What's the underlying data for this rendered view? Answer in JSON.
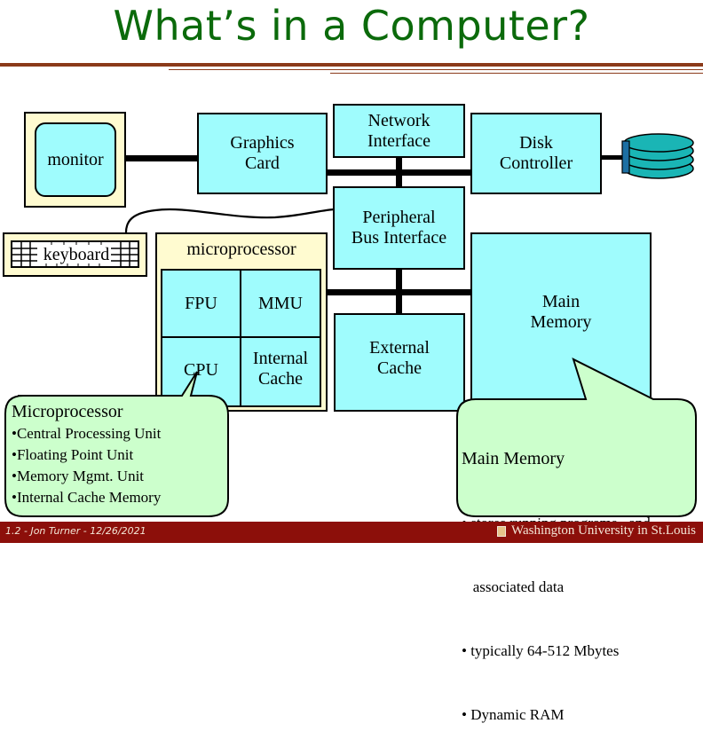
{
  "slide": {
    "title": "What’s in a Computer?"
  },
  "components": {
    "monitor": "monitor",
    "graphics_card": [
      "Graphics",
      "Card"
    ],
    "network_interface": [
      "Network",
      "Interface"
    ],
    "disk_controller": [
      "Disk",
      "Controller"
    ],
    "peripheral_bus_interface": [
      "Peripheral",
      "Bus Interface"
    ],
    "keyboard": "keyboard",
    "microprocessor": "microprocessor",
    "fpu": "FPU",
    "mmu": "MMU",
    "cpu": "CPU",
    "internal_cache": [
      "Internal",
      "Cache"
    ],
    "external_cache": [
      "External",
      "Cache"
    ],
    "main_memory": [
      "Main",
      "Memory"
    ],
    "disk_icon": "disk-stack-icon"
  },
  "callouts": {
    "microprocessor": {
      "title": "Microprocessor",
      "bullets": [
        "•Central Processing Unit",
        "•Floating Point Unit",
        "•Memory Mgmt. Unit",
        "•Internal Cache Memory"
      ]
    },
    "main_memory": {
      "title": "Main Memory",
      "bullets": [
        "• stores running programs   and",
        "   associated data",
        "• typically 64-512 Mbytes",
        "• Dynamic RAM"
      ]
    }
  },
  "footer": {
    "left": "1.2 - Jon Turner - 12/26/2021",
    "right": "Washington University in St.Louis"
  },
  "colors": {
    "title": "#0b6a0b",
    "component_fill": "#9ffcfd",
    "container_fill": "#fffbd0",
    "callout_fill": "#ccffcc",
    "footer_bg": "#8c0f0a",
    "rule": "#8b3a1a",
    "disk": "#1ab5b5"
  }
}
